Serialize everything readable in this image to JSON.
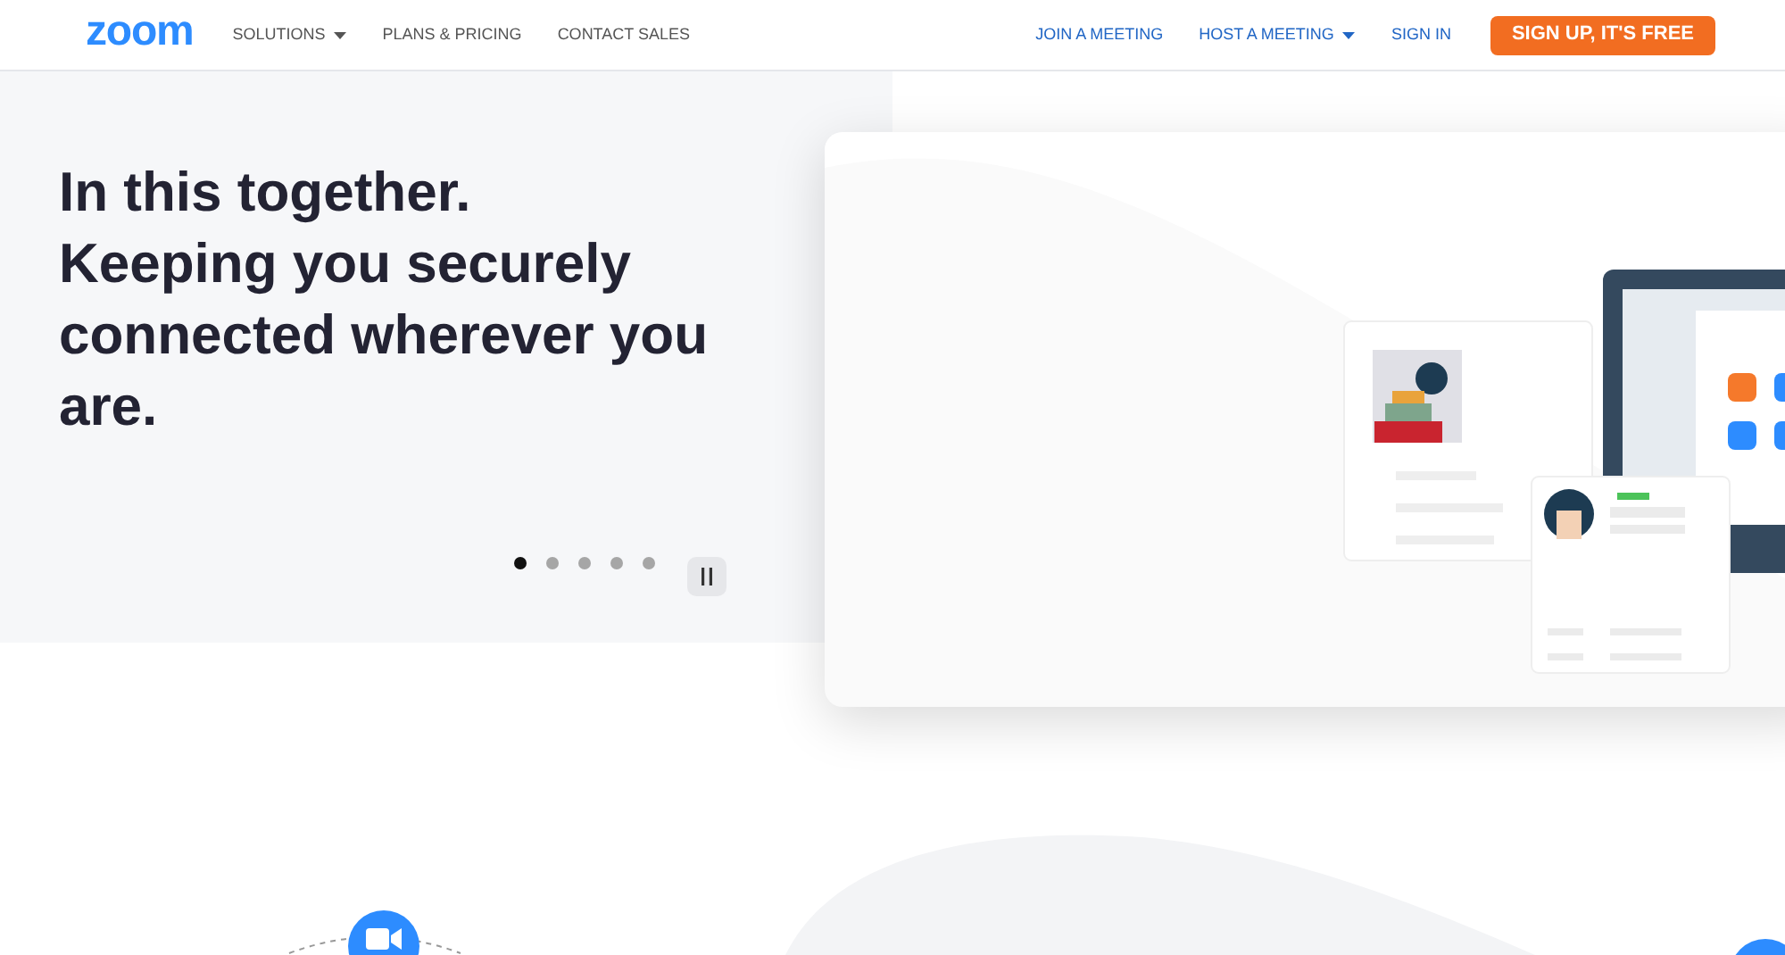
{
  "nav": {
    "logo": "zoom",
    "left_links": [
      {
        "label": "SOLUTIONS",
        "dropdown": true
      },
      {
        "label": "PLANS & PRICING",
        "dropdown": false
      },
      {
        "label": "CONTACT SALES",
        "dropdown": false
      }
    ],
    "right_links": [
      {
        "label": "JOIN A MEETING",
        "dropdown": false
      },
      {
        "label": "HOST A MEETING",
        "dropdown": true
      },
      {
        "label": "SIGN IN",
        "dropdown": false
      }
    ],
    "cta": "SIGN UP, IT'S FREE"
  },
  "hero": {
    "headline": [
      "In this together.",
      "Keeping you securely connected wherever you are."
    ],
    "slides": [
      {
        "selected": true
      },
      {
        "selected": false
      },
      {
        "selected": false
      },
      {
        "selected": false
      },
      {
        "selected": false
      }
    ]
  }
}
